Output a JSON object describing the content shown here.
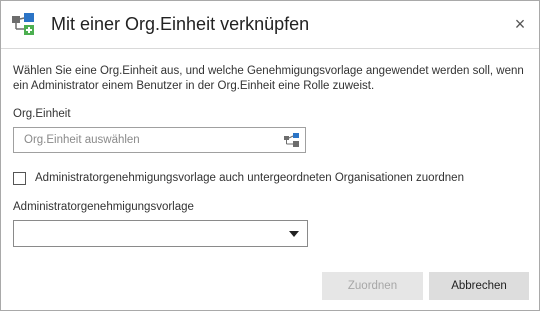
{
  "dialog": {
    "title": "Mit einer Org.Einheit verknüpfen",
    "title_icon": "org-unit-link-icon",
    "close_icon": "close-icon",
    "close_glyph": "×",
    "description": "Wählen Sie eine Org.Einheit aus, und welche Genehmigungsvorlage angewendet werden soll, wenn ein Administrator einem Benutzer in der Org.Einheit eine Rolle zuweist."
  },
  "org_unit": {
    "label": "Org.Einheit",
    "placeholder": "Org.Einheit auswählen",
    "picker_icon": "org-tree-picker-icon"
  },
  "apply_to_children": {
    "label": "Administratorgenehmigungsvorlage auch untergeordneten Organisationen zuordnen",
    "checked": false
  },
  "approval_template": {
    "label": "Administratorgenehmigungsvorlage",
    "selected": ""
  },
  "buttons": {
    "assign": "Zuordnen",
    "assign_enabled": false,
    "cancel": "Abbrechen"
  },
  "colors": {
    "icon_gray": "#6d6d6d",
    "icon_blue": "#2b74c6",
    "icon_green": "#4caf50"
  }
}
